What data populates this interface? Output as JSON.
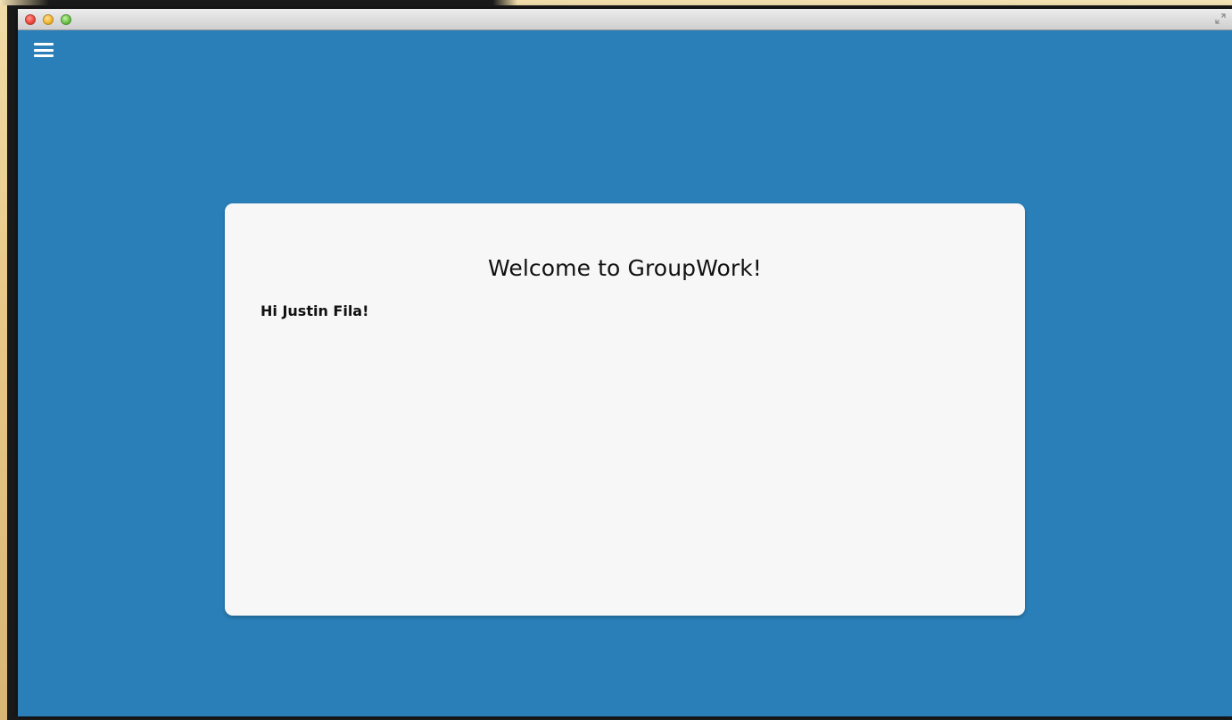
{
  "window": {
    "controls": {
      "close_icon": "close-icon",
      "minimize_icon": "minimize-icon",
      "zoom_icon": "zoom-icon",
      "fullscreen_icon": "fullscreen-icon"
    },
    "background_color": "#2a7fb9"
  },
  "header": {
    "menu_icon": "hamburger-menu-icon"
  },
  "welcome_card": {
    "title": "Welcome to GroupWork!",
    "greeting": "Hi Justin Fila!",
    "background_color": "#f7f7f7"
  }
}
